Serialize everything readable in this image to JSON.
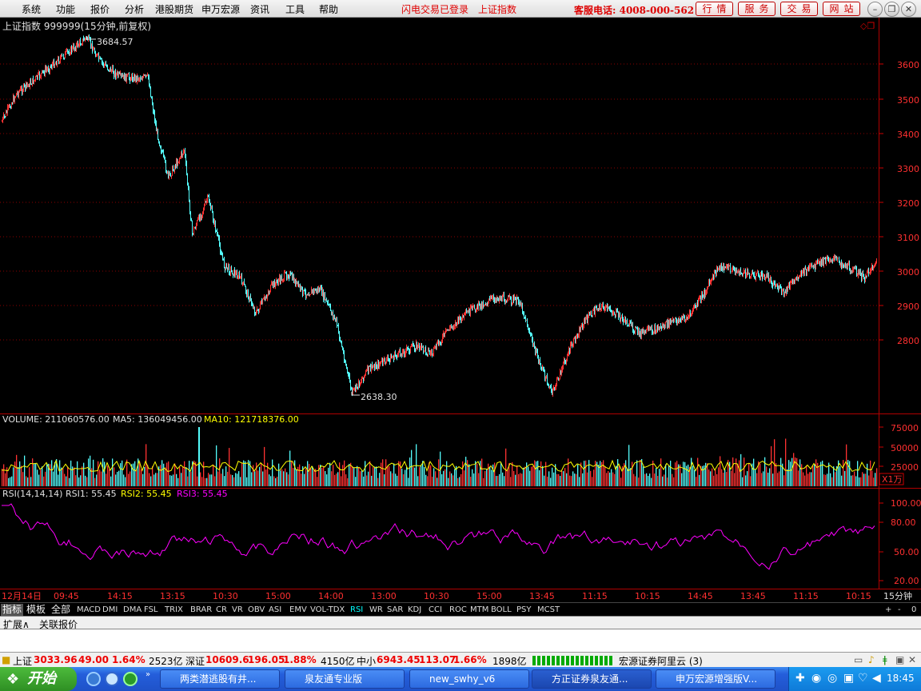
{
  "menu": {
    "items": [
      "系统",
      "功能",
      "报价",
      "分析",
      "港股期货",
      "申万宏源",
      "资讯",
      "工具",
      "帮助"
    ],
    "flash_status": "闪电交易已登录",
    "current_index": "上证指数",
    "service_phone": "客服电话: 4008-000-562",
    "buttons": [
      "行情",
      "服务",
      "交易",
      "网站"
    ]
  },
  "chart_header": {
    "title": "上证指数 999999(15分钟,前复权)",
    "high_label": "3684.57",
    "low_label": "2638.30"
  },
  "price_axis": {
    "ticks": [
      "3600",
      "3500",
      "3400",
      "3300",
      "3200",
      "3100",
      "3000",
      "2900",
      "2800"
    ]
  },
  "volume": {
    "label": "VOLUME: 211060576.00",
    "ma5": "MA5: 136049456.00",
    "ma10": "MA10: 121718376.00",
    "ticks": [
      "75000",
      "50000",
      "25000"
    ],
    "unit": "X1万"
  },
  "rsi": {
    "label": "RSI(14,14,14)",
    "rsi1": "RSI1: 55.45",
    "rsi2": "RSI2: 55.45",
    "rsi3": "RSI3: 55.45",
    "ticks": [
      "100.00",
      "80.00",
      "50.00",
      "20.00"
    ]
  },
  "time_axis": {
    "labels": [
      "12月14日",
      "09:45",
      "14:15",
      "13:15",
      "10:30",
      "15:00",
      "14:00",
      "13:00",
      "10:30",
      "15:00",
      "13:45",
      "11:15",
      "10:15",
      "14:45",
      "13:45",
      "11:15",
      "10:15"
    ],
    "period": "15分钟"
  },
  "indicator_tabs": {
    "lead": [
      "指标",
      "模板",
      "全部"
    ],
    "items": [
      "MACD",
      "DMI",
      "DMA",
      "FSL",
      "TRIX",
      "BRAR",
      "CR",
      "VR",
      "OBV",
      "ASI",
      "EMV",
      "VOL-TDX",
      "RSI",
      "WR",
      "SAR",
      "KDJ",
      "CCI",
      "ROC",
      "MTM",
      "BOLL",
      "PSY",
      "MCST"
    ],
    "selected": "RSI",
    "right_buttons": [
      "+",
      "-",
      "0"
    ]
  },
  "bottom_tabs": [
    "扩展∧",
    "关联报价"
  ],
  "status_bar": {
    "sh_label": "上证",
    "sh_value": "3033.96",
    "sh_change": "49.00",
    "sh_pct": "1.64%",
    "sh_amount": "2523亿",
    "sz_label": "深证",
    "sz_value": "10609.6",
    "sz_change": "196.05",
    "sz_pct": "1.88%",
    "sz_amount": "4150亿",
    "zx_label": "中小",
    "zx_value": "6943.45",
    "zx_change": "113.07",
    "zx_pct": "1.66%",
    "zx_amount": "1898亿",
    "server": "宏源证券阿里云 (3)"
  },
  "taskbar": {
    "start": "开始",
    "tasks": [
      "两类潜逃股有井...",
      "泉友通专业版",
      "new_swhy_v6",
      "方正证券泉友通...",
      "申万宏源增强版V..."
    ],
    "clock": "18:45"
  },
  "colors": {
    "up": "#ff3232",
    "down": "#54fcfc",
    "ma10": "#ffff00",
    "rsi": "#ff00ff",
    "grid": "#8b0000"
  }
}
